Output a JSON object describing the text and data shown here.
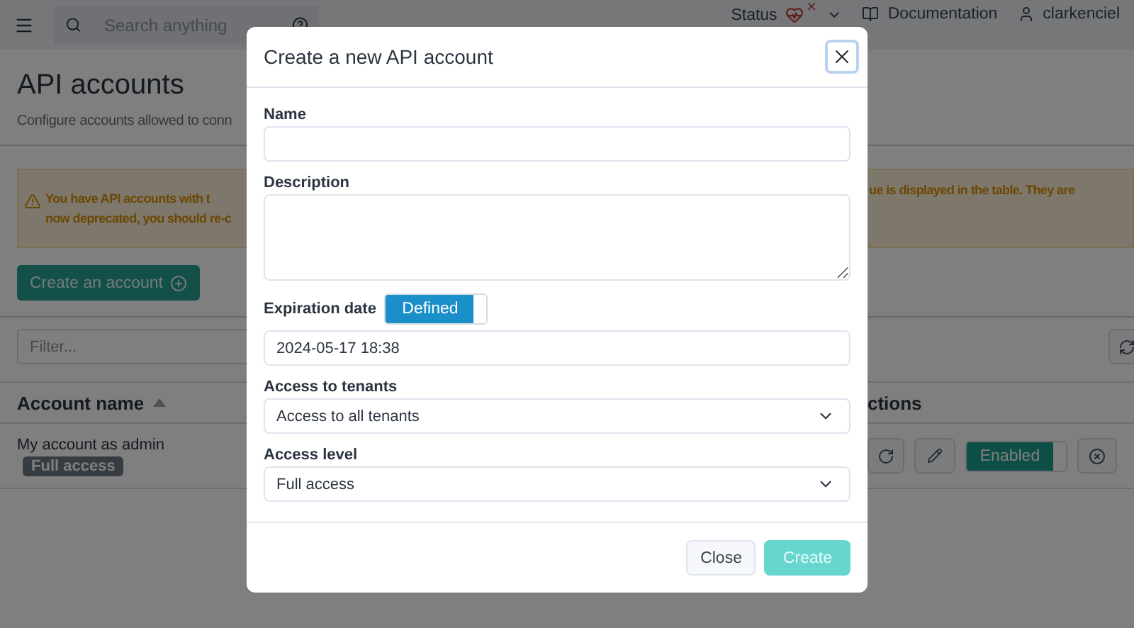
{
  "topbar": {
    "search": {
      "placeholder": "Search anything"
    },
    "status_label": "Status",
    "links": [
      "Documentation",
      "clarkenciel"
    ]
  },
  "page": {
    "title": "API accounts",
    "subtitle": "Configure accounts allowed to conn",
    "warning": {
      "left_lines": [
        "You have API accounts with t",
        "now deprecated, you should re-c"
      ],
      "right_line": "ue is displayed in the table. They are"
    },
    "create_button": "Create an account",
    "filter": {
      "placeholder": "Filter..."
    },
    "table": {
      "columns": [
        "Account name",
        "ctions"
      ],
      "rows": [
        {
          "name": "My account as admin",
          "badge": "Full access",
          "toggle": {
            "label": "Enabled",
            "on": true
          }
        }
      ]
    }
  },
  "dialog": {
    "title": "Create a new API account",
    "fields": [
      {
        "kind": "text",
        "label": "Name"
      },
      {
        "kind": "textarea",
        "label": "Description"
      },
      {
        "kind": "date",
        "label": "Expiration date",
        "toggle": {
          "label": "Defined",
          "on": true
        },
        "value": "2024-05-17 18:38"
      },
      {
        "kind": "select",
        "label": "Access to tenants",
        "value": "Access to all tenants"
      },
      {
        "kind": "select",
        "label": "Access level",
        "value": "Full access"
      }
    ],
    "buttons": [
      {
        "kind": "secondary",
        "label": "Close",
        "disabled": false
      },
      {
        "kind": "primary",
        "label": "Create",
        "disabled": true
      }
    ]
  }
}
